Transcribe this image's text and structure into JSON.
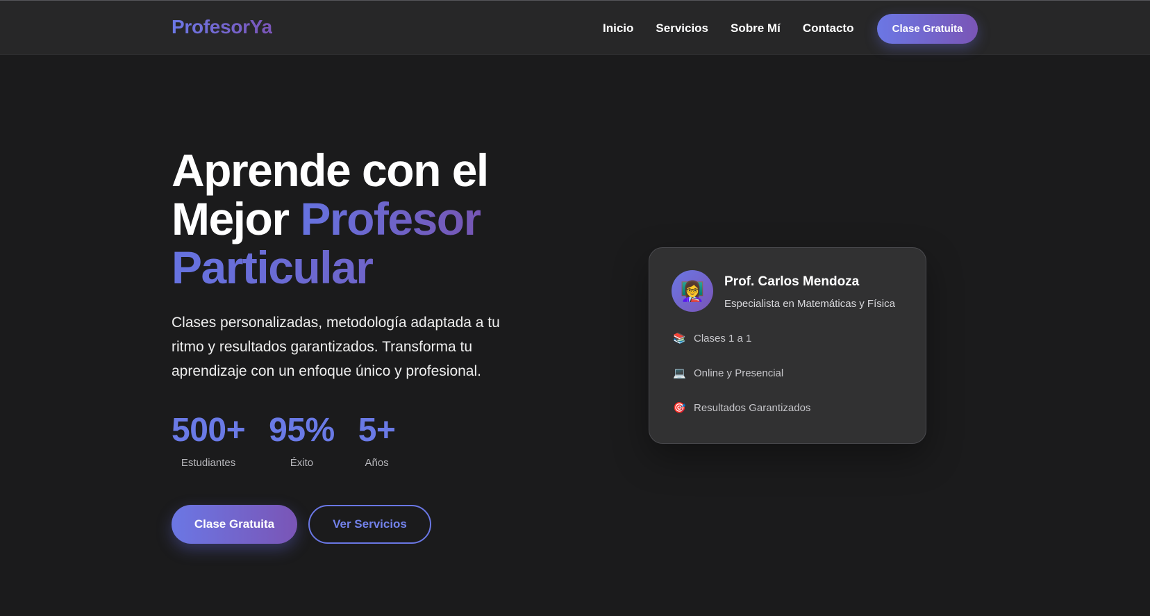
{
  "nav": {
    "logo": "ProfesorYa",
    "links": [
      "Inicio",
      "Servicios",
      "Sobre Mí",
      "Contacto"
    ],
    "cta": "Clase Gratuita"
  },
  "hero": {
    "title_line1": "Aprende con el",
    "title_line2_plain": "Mejor ",
    "title_line2_accent": "Profesor",
    "title_line3_accent": "Particular",
    "description": "Clases personalizadas, metodología adaptada a tu ritmo y resultados garantizados. Transforma tu aprendizaje con un enfoque único y profesional.",
    "stats": [
      {
        "value": "500+",
        "label": "Estudiantes"
      },
      {
        "value": "95%",
        "label": "Éxito"
      },
      {
        "value": "5+",
        "label": "Años"
      }
    ],
    "primary_button": "Clase Gratuita",
    "secondary_button": "Ver Servicios"
  },
  "card": {
    "avatar_icon": "👩‍🏫",
    "name": "Prof. Carlos Mendoza",
    "specialty": "Especialista en Matemáticas y Física",
    "features": [
      {
        "icon": "📚",
        "icon_name": "books-icon",
        "text": "Clases 1 a 1"
      },
      {
        "icon": "💻",
        "icon_name": "laptop-icon",
        "text": "Online y Presencial"
      },
      {
        "icon": "🎯",
        "icon_name": "target-icon",
        "text": "Resultados Garantizados"
      }
    ]
  },
  "colors": {
    "background": "#1b1b1c",
    "navbar": "#272728",
    "accent_start": "#6b77e4",
    "accent_end": "#7a55b6",
    "card": "#313132"
  }
}
